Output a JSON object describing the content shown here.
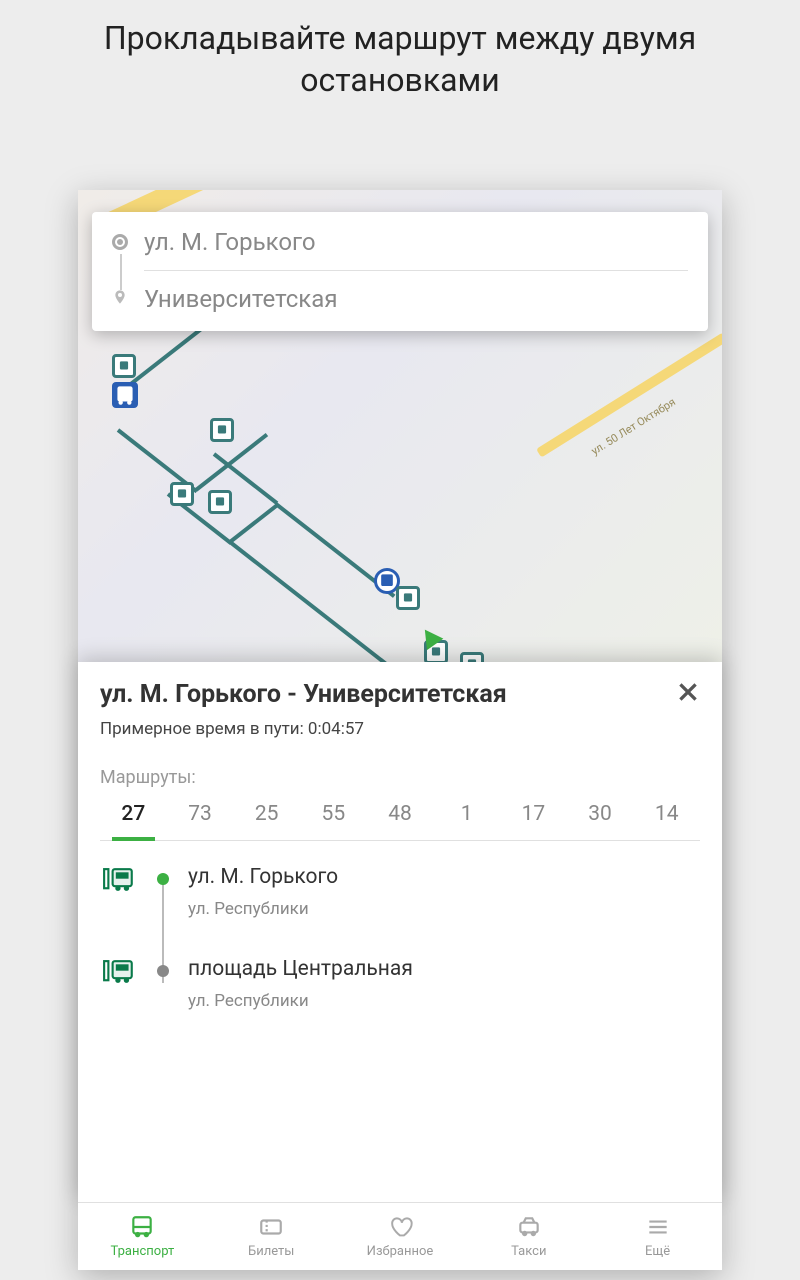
{
  "header": "Прокладывайте маршрут между двумя остановками",
  "search": {
    "origin": "ул. М. Горького",
    "destination": "Университетская"
  },
  "map": {
    "street_label": "ул. 50 Лет Октября"
  },
  "panel": {
    "title": "ул. М. Горького - Университетская",
    "time_label": "Примерное время в пути: 0:04:57",
    "routes_label": "Маршруты:",
    "routes": [
      "27",
      "73",
      "25",
      "55",
      "48",
      "1",
      "17",
      "30",
      "14"
    ],
    "active_route": "27",
    "stops": [
      {
        "name": "ул. М. Горького",
        "sub": "ул. Республики",
        "type": "start"
      },
      {
        "name": "площадь Центральная",
        "sub": "ул. Республики",
        "type": "mid"
      }
    ]
  },
  "nav": {
    "items": [
      {
        "label": "Транспорт",
        "icon": "bus",
        "active": true
      },
      {
        "label": "Билеты",
        "icon": "ticket",
        "active": false
      },
      {
        "label": "Избранное",
        "icon": "heart",
        "active": false
      },
      {
        "label": "Такси",
        "icon": "taxi",
        "active": false
      },
      {
        "label": "Ещё",
        "icon": "more",
        "active": false
      }
    ]
  }
}
